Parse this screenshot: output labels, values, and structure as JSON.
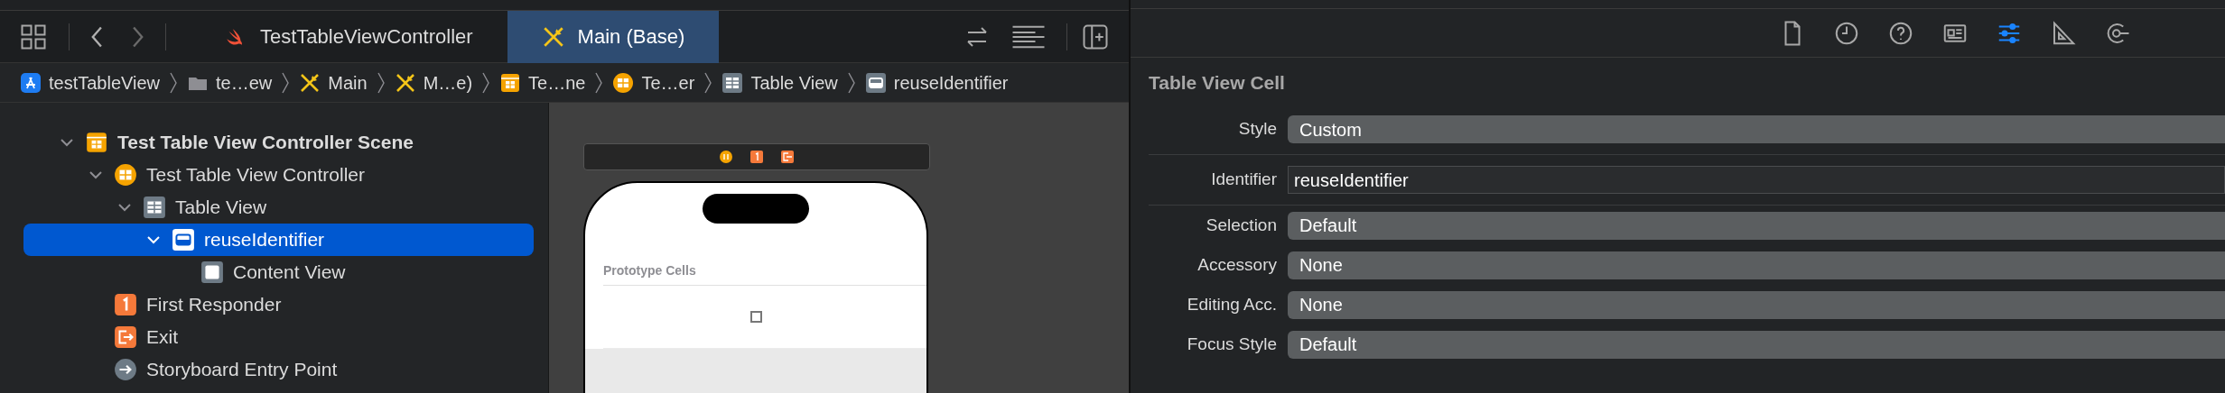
{
  "tabs": [
    {
      "label": "TestTableViewController",
      "kind": "swift",
      "selected": false
    },
    {
      "label": "Main (Base)",
      "kind": "storyboard",
      "selected": true
    }
  ],
  "breadcrumb": [
    {
      "label": "testTableView",
      "kind": "app"
    },
    {
      "label": "te…ew",
      "kind": "folder"
    },
    {
      "label": "Main",
      "kind": "storyboard"
    },
    {
      "label": "M…e)",
      "kind": "storyboard"
    },
    {
      "label": "Te…ne",
      "kind": "scene"
    },
    {
      "label": "Te…er",
      "kind": "controller"
    },
    {
      "label": "Table View",
      "kind": "table"
    },
    {
      "label": "reuseIdentifier",
      "kind": "cell"
    }
  ],
  "outline": [
    {
      "label": "Test Table View Controller Scene",
      "kind": "scene",
      "expanded": true,
      "selected": false,
      "children": [
        {
          "label": "Test Table View Controller",
          "kind": "controller",
          "expanded": true,
          "selected": false,
          "children": [
            {
              "label": "Table View",
              "kind": "table",
              "expanded": true,
              "selected": false,
              "children": [
                {
                  "label": "reuseIdentifier",
                  "kind": "cell",
                  "expanded": true,
                  "selected": true,
                  "children": [
                    {
                      "label": "Content View",
                      "kind": "view",
                      "selected": false
                    }
                  ]
                }
              ]
            }
          ]
        },
        {
          "label": "First Responder",
          "kind": "responder",
          "selected": false
        },
        {
          "label": "Exit",
          "kind": "exit",
          "selected": false
        },
        {
          "label": "Storyboard Entry Point",
          "kind": "entry",
          "selected": false
        }
      ]
    }
  ],
  "canvas": {
    "section_header": "Prototype Cells"
  },
  "inspector": {
    "tools": [
      {
        "kind": "file",
        "selected": false
      },
      {
        "kind": "history",
        "selected": false
      },
      {
        "kind": "help",
        "selected": false
      },
      {
        "kind": "identity",
        "selected": false
      },
      {
        "kind": "attributes",
        "selected": true
      },
      {
        "kind": "size",
        "selected": false
      },
      {
        "kind": "connections",
        "selected": false
      }
    ],
    "title": "Table View Cell",
    "fields": [
      {
        "label": "Style",
        "value": "Custom",
        "kind": "popup"
      },
      {
        "label": "Identifier",
        "value": "reuseIdentifier",
        "kind": "text"
      },
      {
        "label": "Selection",
        "value": "Default",
        "kind": "popup"
      },
      {
        "label": "Accessory",
        "value": "None",
        "kind": "popup"
      },
      {
        "label": "Editing Acc.",
        "value": "None",
        "kind": "popup"
      },
      {
        "label": "Focus Style",
        "value": "Default",
        "kind": "popup"
      }
    ]
  }
}
